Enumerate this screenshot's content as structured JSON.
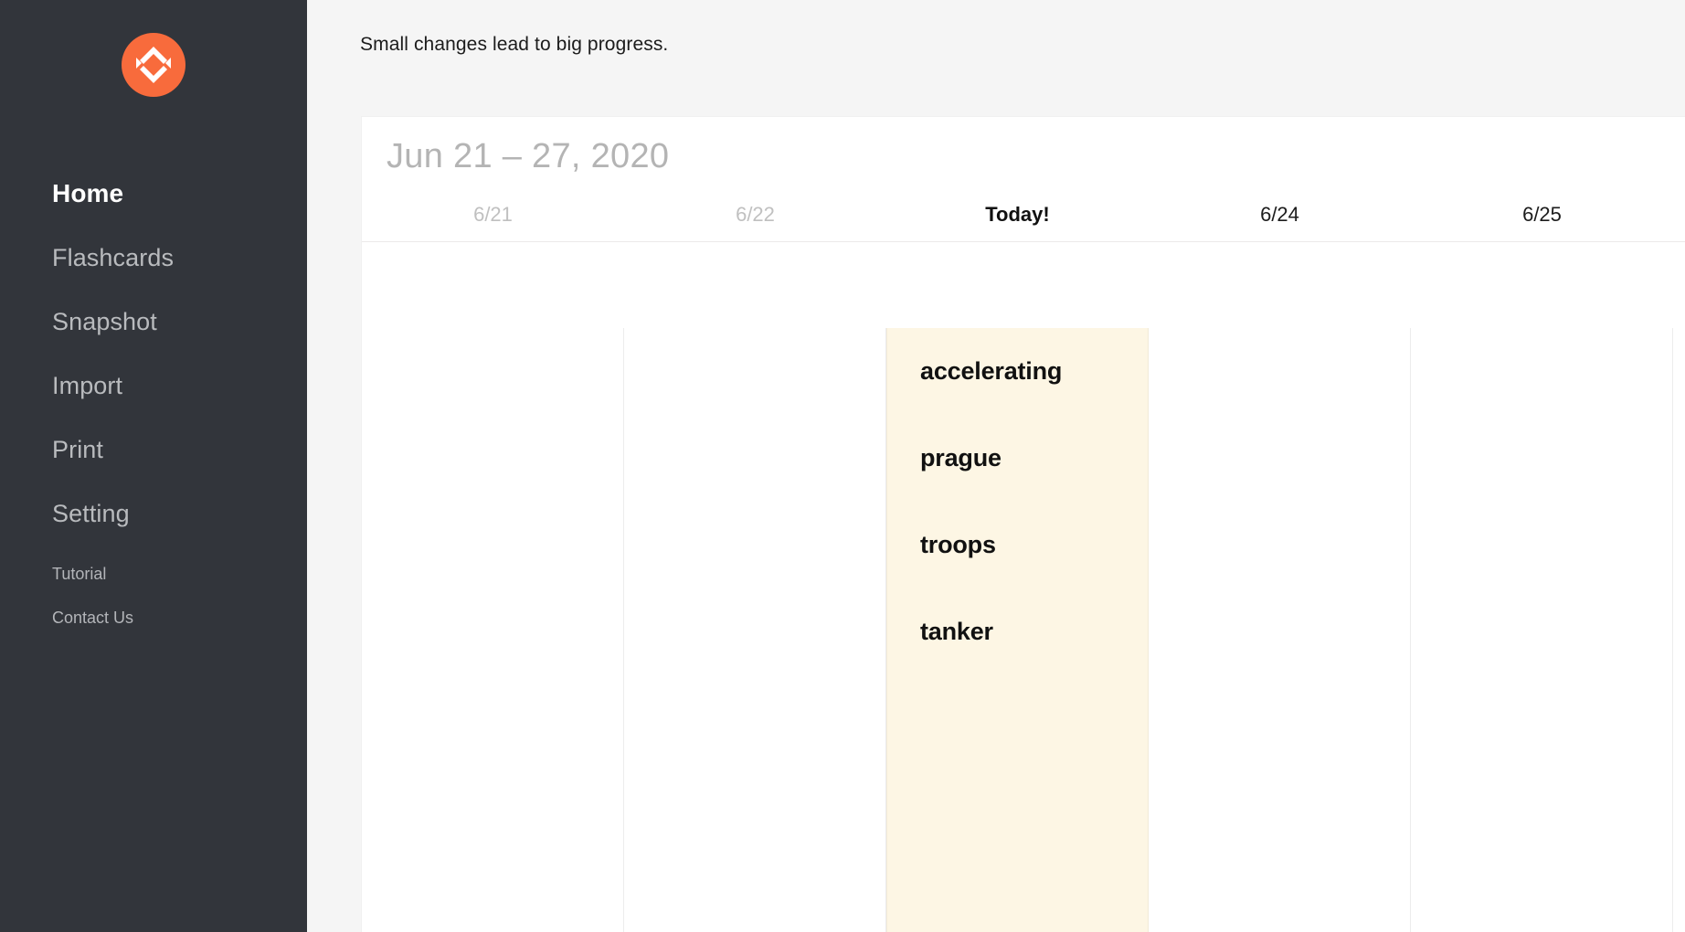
{
  "brand": {
    "logo_icon": "diamond-arrows-logo-icon",
    "logo_color": "#f86b3c",
    "logo_mark_color": "#ffffff"
  },
  "sidebar": {
    "background": "#32353b",
    "items": [
      {
        "label": "Home",
        "active": true,
        "name": "sidebar-item-home"
      },
      {
        "label": "Flashcards",
        "active": false,
        "name": "sidebar-item-flashcards"
      },
      {
        "label": "Snapshot",
        "active": false,
        "name": "sidebar-item-snapshot"
      },
      {
        "label": "Import",
        "active": false,
        "name": "sidebar-item-import"
      },
      {
        "label": "Print",
        "active": false,
        "name": "sidebar-item-print"
      },
      {
        "label": "Setting",
        "active": false,
        "name": "sidebar-item-setting"
      }
    ],
    "subitems": [
      {
        "label": "Tutorial",
        "name": "sidebar-subitem-tutorial"
      },
      {
        "label": "Contact Us",
        "name": "sidebar-subitem-contact-us"
      }
    ]
  },
  "header": {
    "tagline": "Small changes lead to big progress."
  },
  "calendar": {
    "week_range": "Jun 21 – 27, 2020",
    "today_background": "#fdf6e4",
    "columns": [
      {
        "label": "6/21",
        "is_today": false,
        "style": "muted",
        "words": []
      },
      {
        "label": "6/22",
        "is_today": false,
        "style": "muted",
        "words": []
      },
      {
        "label": "Today!",
        "is_today": true,
        "style": "today",
        "words": [
          "accelerating",
          "prague",
          "troops",
          "tanker"
        ]
      },
      {
        "label": "6/24",
        "is_today": false,
        "style": "dark",
        "words": []
      },
      {
        "label": "6/25",
        "is_today": false,
        "style": "dark",
        "words": []
      },
      {
        "label": "",
        "is_today": false,
        "style": "muted",
        "words": []
      }
    ]
  }
}
